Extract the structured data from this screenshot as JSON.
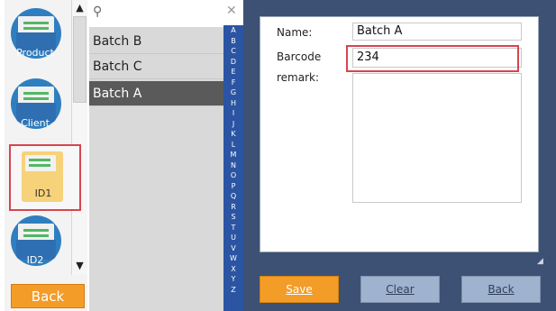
{
  "categories": [
    {
      "label": "Product",
      "icon": "product-icon"
    },
    {
      "label": "Client",
      "icon": "client-icon"
    },
    {
      "label": "ID1",
      "icon": "id1-icon"
    },
    {
      "label": "ID2",
      "icon": "id2-icon"
    }
  ],
  "back_left_label": "Back",
  "search": {
    "placeholder": ""
  },
  "list": {
    "items": [
      "Batch B",
      "Batch C",
      "Batch A"
    ]
  },
  "alphabet": [
    "A",
    "B",
    "C",
    "D",
    "E",
    "F",
    "G",
    "H",
    "I",
    "J",
    "K",
    "L",
    "M",
    "N",
    "O",
    "P",
    "Q",
    "R",
    "S",
    "T",
    "U",
    "V",
    "W",
    "X",
    "Y",
    "Z"
  ],
  "form": {
    "name_label": "Name:",
    "name_value": "Batch A",
    "barcode_label": "Barcode",
    "barcode_value": "234",
    "remark_label": "remark:",
    "remark_value": ""
  },
  "buttons": {
    "save": "Save",
    "clear": "Clear",
    "back": "Back"
  },
  "colors": {
    "accent_orange": "#f39c27",
    "panel_blue": "#3c5173",
    "alpha_blue": "#2b55a3",
    "highlight_red": "#d64550"
  }
}
